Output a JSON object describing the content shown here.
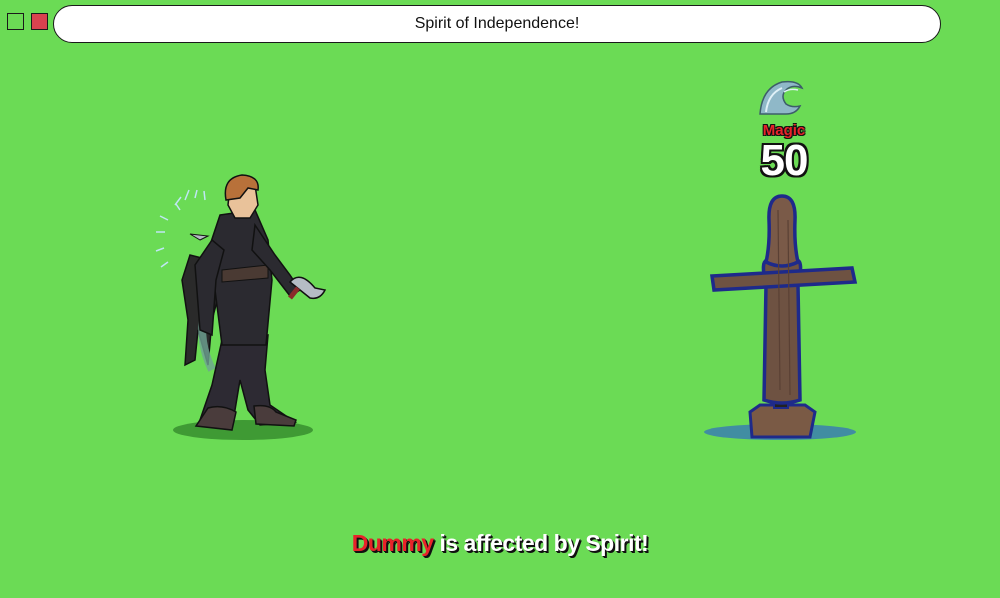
{
  "window": {
    "title": "Spirit of Independence!"
  },
  "combat": {
    "damage_type": "Magic",
    "damage_value": "50",
    "effect_icon": "water-wave-icon"
  },
  "message": {
    "target": "Dummy",
    "text": " is affected by Spirit!"
  },
  "colors": {
    "background": "#6bdb55",
    "damage_type": "#e8232a",
    "target_name": "#e8232a",
    "close_button": "#d9424f"
  }
}
